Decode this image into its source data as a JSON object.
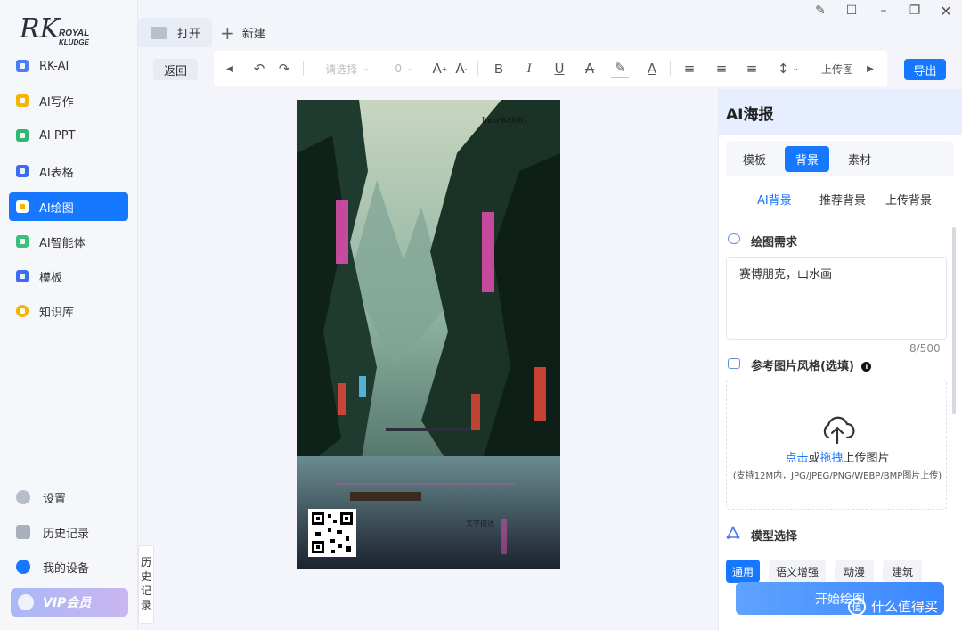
{
  "app": {
    "logo_text_rk": "RK",
    "logo_text_royal": "ROYAL",
    "logo_text_kludge": "KLUDGE"
  },
  "sidebar": {
    "items": [
      {
        "label": "RK-AI",
        "color": "#4c7bf5",
        "active": false
      },
      {
        "label": "AI写作",
        "color": "#f5b400",
        "active": false
      },
      {
        "label": "AI PPT",
        "color": "#2eb872",
        "active": false
      },
      {
        "label": "AI表格",
        "color": "#3a6df0",
        "active": false
      },
      {
        "label": "AI绘图",
        "color": "#f5b400",
        "active": true
      },
      {
        "label": "AI智能体",
        "color": "#39c07a",
        "active": false
      },
      {
        "label": "模板",
        "color": "#3a6df0",
        "active": false
      },
      {
        "label": "知识库",
        "color": "#f5b400",
        "active": false
      }
    ],
    "bottom": [
      {
        "label": "设置",
        "color": "#b8bec9"
      },
      {
        "label": "历史记录",
        "color": "#a9b0bc"
      },
      {
        "label": "我的设备",
        "color": "#1677ff"
      }
    ],
    "vip_label": "VIP会员"
  },
  "tabs": {
    "open_label": "打开",
    "new_label": "新建"
  },
  "toolbar": {
    "back_label": "返回",
    "select_placeholder": "请选择",
    "font_size": "0",
    "upload_image_label": "上传图",
    "export_label": "导出"
  },
  "poster": {
    "top_text": "Inno·KOOG",
    "bottom_text": "文字描述"
  },
  "history_tab": "历史记录",
  "panel": {
    "title": "AI海报",
    "tabs": [
      {
        "label": "模板",
        "active": false
      },
      {
        "label": "背景",
        "active": true
      },
      {
        "label": "素材",
        "active": false
      }
    ],
    "subtabs": [
      {
        "label": "AI背景",
        "active": true
      },
      {
        "label": "推荐背景",
        "active": false
      },
      {
        "label": "上传背景",
        "active": false
      }
    ],
    "prompt_title": "绘图需求",
    "prompt_value": "赛博朋克，山水画",
    "prompt_counter": "8/500",
    "ref_title": "参考图片风格(选填)",
    "upload_click": "点击",
    "upload_or": "或",
    "upload_drag": "拖拽",
    "upload_rest": "上传图片",
    "upload_hint": "(支持12M内，JPG/JPEG/PNG/WEBP/BMP图片上传)",
    "model_title": "模型选择",
    "models": [
      {
        "label": "通用",
        "active": true
      },
      {
        "label": "语义增强",
        "active": false
      },
      {
        "label": "动漫",
        "active": false
      },
      {
        "label": "建筑",
        "active": false
      }
    ],
    "generate_label": "开始绘图"
  },
  "watermark": "什么值得买"
}
